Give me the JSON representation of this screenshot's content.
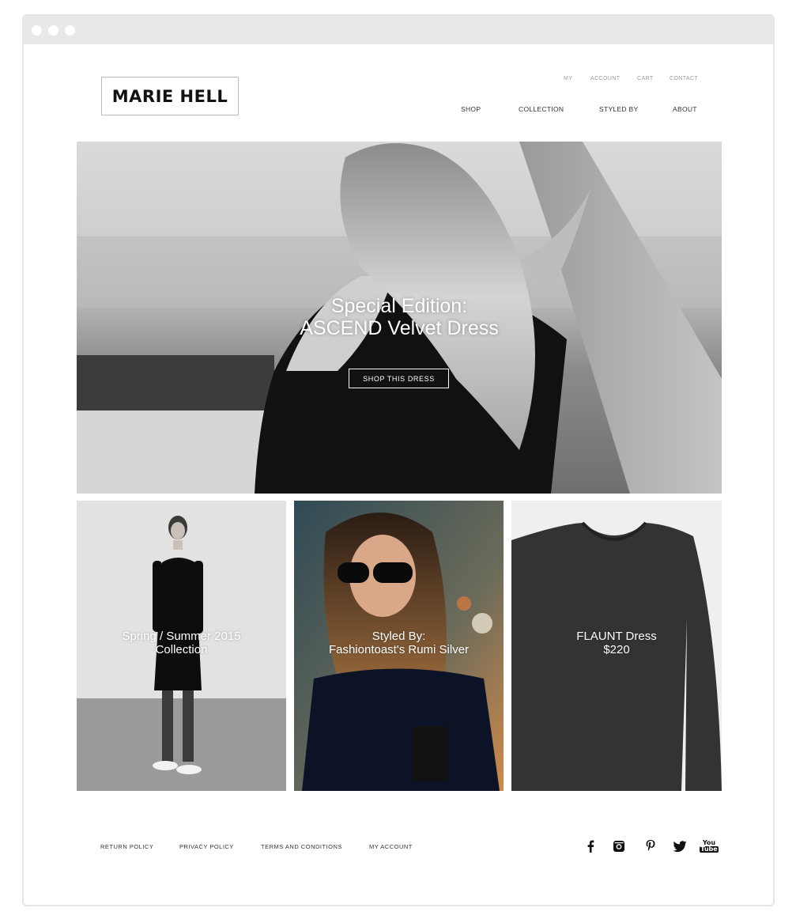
{
  "brand": {
    "name": "MARIE HELL"
  },
  "utility_nav": [
    "MY",
    "ACCOUNT",
    "CART",
    "CONTACT"
  ],
  "main_nav": [
    "SHOP",
    "COLLECTION",
    "STYLED BY",
    "ABOUT"
  ],
  "hero": {
    "title_line1": "Special Edition:",
    "title_line2": "ASCEND Velvet Dress",
    "button_label": "SHOP THIS DRESS"
  },
  "tiles": [
    {
      "line1": "Spring / Summer 2015",
      "line2": "Collection"
    },
    {
      "line1": "Styled By:",
      "line2": "Fashiontoast's Rumi Silver"
    },
    {
      "line1": "FLAUNT Dress",
      "line2": "$220"
    }
  ],
  "footer": {
    "links": [
      "RETURN POLICY",
      "PRIVACY POLICY",
      "TERMS AND CONDITIONS",
      "MY ACCOUNT"
    ],
    "social_icons": [
      "facebook-icon",
      "instagram-icon",
      "pinterest-icon",
      "twitter-icon",
      "youtube-icon"
    ],
    "youtube_line1": "You",
    "youtube_line2": "Tube"
  }
}
